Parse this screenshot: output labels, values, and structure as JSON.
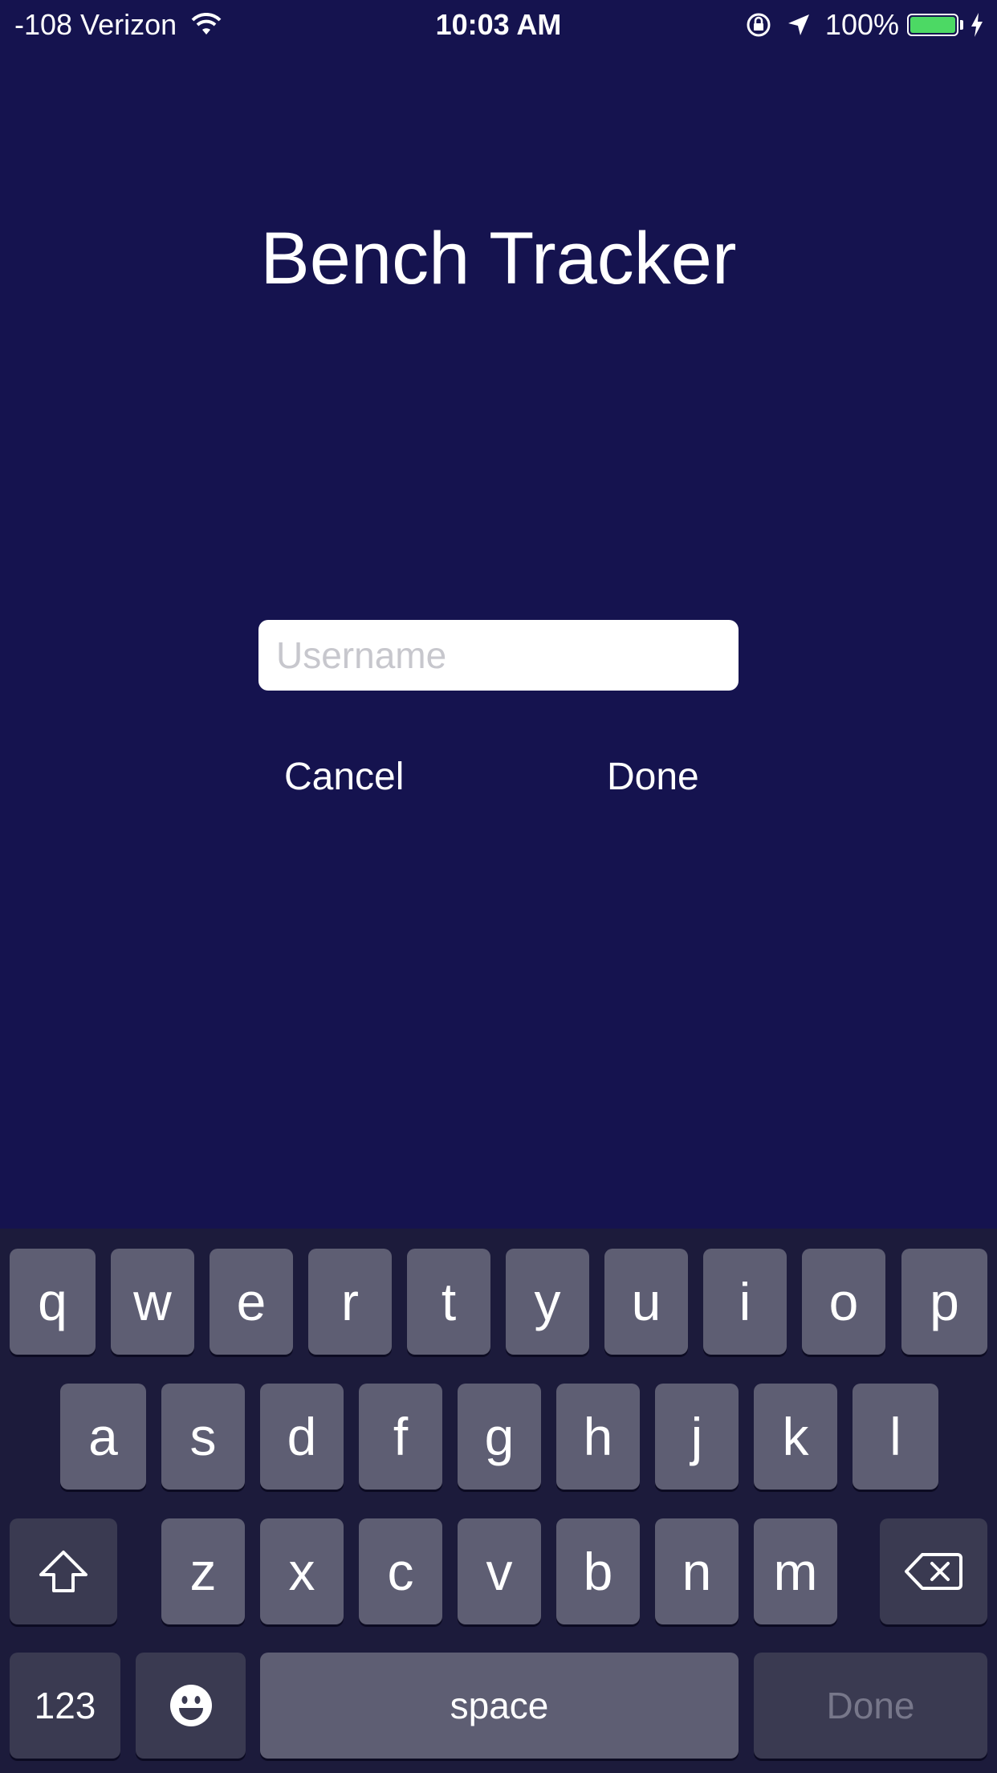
{
  "status_bar": {
    "carrier": "-108 Verizon",
    "time": "10:03 AM",
    "battery": "100%"
  },
  "app": {
    "title": "Bench Tracker",
    "username_placeholder": "Username",
    "username_value": "",
    "cancel_label": "Cancel",
    "done_label": "Done"
  },
  "keyboard": {
    "row1": [
      "q",
      "w",
      "e",
      "r",
      "t",
      "y",
      "u",
      "i",
      "o",
      "p"
    ],
    "row2": [
      "a",
      "s",
      "d",
      "f",
      "g",
      "h",
      "j",
      "k",
      "l"
    ],
    "row3": [
      "z",
      "x",
      "c",
      "v",
      "b",
      "n",
      "m"
    ],
    "numbers_label": "123",
    "space_label": "space",
    "return_label": "Done"
  },
  "colors": {
    "background": "#15134f",
    "keyboard_bg": "#1c1b3b",
    "key": "#5e5e73",
    "key_dark": "#3a3a51",
    "battery": "#4cd964"
  }
}
